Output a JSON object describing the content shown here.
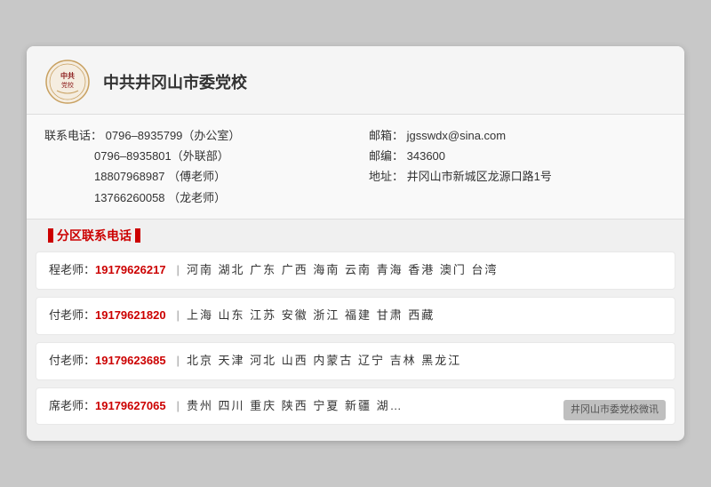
{
  "header": {
    "school_name": "中共井冈山市委党校"
  },
  "contact": {
    "phone_label": "联系电话：",
    "phone1": "0796–8935799（办公室）",
    "phone2": "0796–8935801（外联部）",
    "phone3": "18807968987 （傅老师）",
    "phone4": "13766260058 （龙老师）",
    "email_label": "邮箱：",
    "email": "jgsswdx@sina.com",
    "postal_label": "邮编：",
    "postal": "343600",
    "address_label": "地址：",
    "address": "井冈山市新城区龙源口路1号"
  },
  "section_title": "分区联系电话",
  "regions": [
    {
      "teacher": "程老师：",
      "phone": "19179626217",
      "areas": "河南  湖北  广东  广西  海南  云南  青海  香港  澳门  台湾"
    },
    {
      "teacher": "付老师：",
      "phone": "19179621820",
      "areas": "上海  山东  江苏  安徽  浙江  福建  甘肃  西藏"
    },
    {
      "teacher": "付老师：",
      "phone": "19179623685",
      "areas": "北京  天津  河北  山西  内蒙古  辽宁  吉林  黑龙江"
    },
    {
      "teacher": "席老师：",
      "phone": "19179627065",
      "areas": "贵州  四川  重庆  陕西  宁夏  新疆  湖…",
      "watermark": "井冈山市委党校微讯"
    }
  ]
}
